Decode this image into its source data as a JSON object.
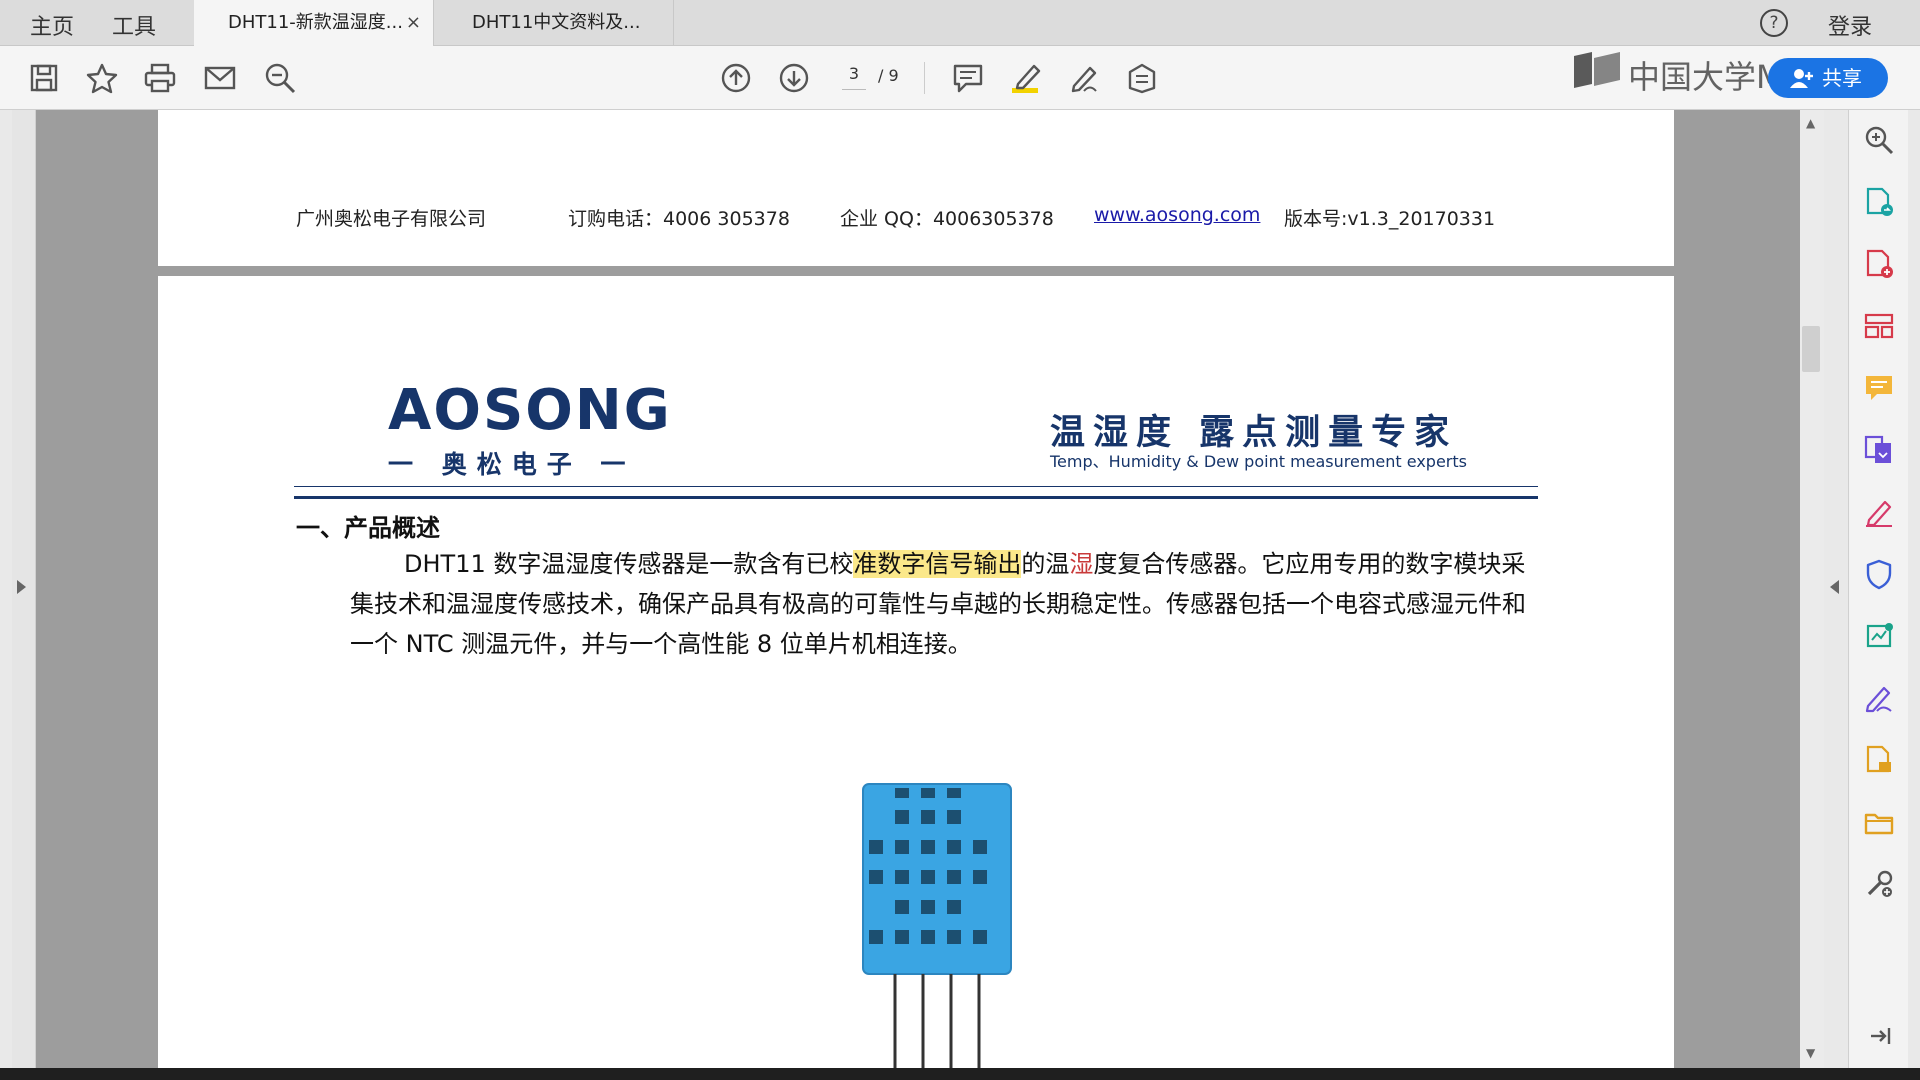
{
  "nav": {
    "home": "主页",
    "tools": "工具"
  },
  "tabs": [
    {
      "label": "DHT11-新款温湿度...",
      "close": "×"
    },
    {
      "label": "DHT11中文资料及..."
    }
  ],
  "header_right": {
    "help": "?",
    "login": "登录"
  },
  "toolbar": {
    "icons": [
      "save-icon",
      "star-icon",
      "print-icon",
      "mail-icon",
      "zoom-out-icon",
      "prev-page-icon",
      "next-page-icon",
      "comment-icon",
      "highlight-icon",
      "sign-icon",
      "stamp-icon"
    ],
    "page_current": "3",
    "page_total": "/ 9"
  },
  "watermark": {
    "text": "中国大学MOOC"
  },
  "share": {
    "label": "共享"
  },
  "document": {
    "page_header": {
      "company": "广州奥松电子有限公司",
      "phone": "订购电话：4006 305378",
      "qq": "企业 QQ：4006305378",
      "website": "www.aosong.com",
      "version": "版本号:v1.3_20170331"
    },
    "brand": {
      "logo_main": "AOSONG",
      "logo_sub": "一 奥松电子 一",
      "tagline_cn": "温湿度  露点测量专家",
      "tagline_en": "Temp、Humidity & Dew point measurement experts"
    },
    "section_title": "一、产品概述",
    "paragraph": {
      "part1": "DHT11 数字温湿度传感器是一款含有已校",
      "highlight": "准数字信号输出",
      "part2": "的温",
      "cursor_char": "湿",
      "part3": "度复合传感器。它应用专用的数字模块采集技术和温湿度传感技术，确保产品具有极高的可靠性与卓越的长期稳定性。传感器包括一个电容式感湿元件和一个 NTC 测温元件，并与一个高性能 8 位单片机相连接。"
    },
    "figure": {
      "name": "DHT11 sensor"
    }
  },
  "right_panel": {
    "icons": [
      "zoom-icon",
      "export-pdf-icon",
      "create-pdf-icon",
      "organize-pages-icon",
      "comment-icon",
      "combine-files-icon",
      "fill-sign-icon",
      "protect-icon",
      "optimize-icon",
      "send-sign-icon",
      "export-file-icon",
      "folder-icon",
      "tools-icon",
      "collapse-panel-icon"
    ]
  },
  "colors": {
    "brand_navy": "#17356a",
    "accent_blue": "#1b74e4",
    "highlight": "#fbe88a",
    "sensor_blue": "#3aa5e3"
  }
}
